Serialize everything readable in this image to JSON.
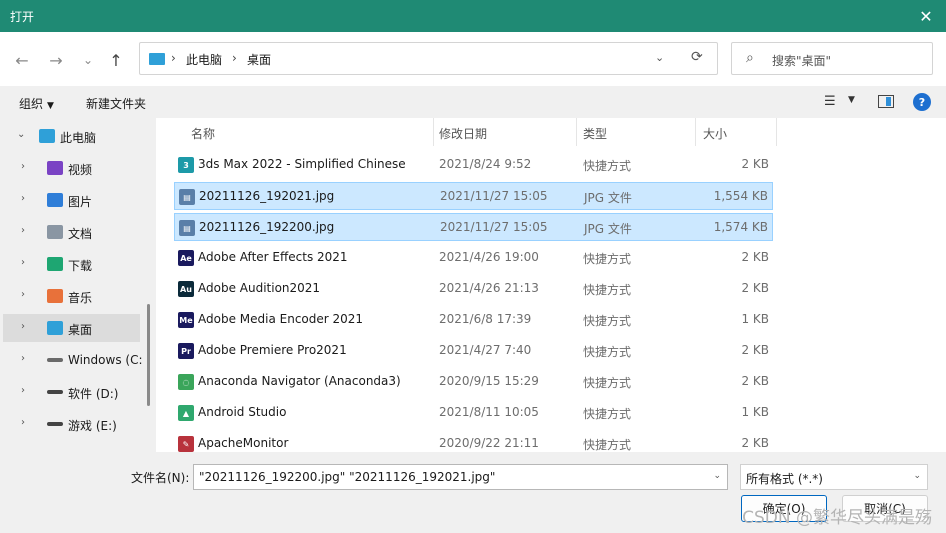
{
  "window": {
    "title": "打开",
    "close_glyph": "✕"
  },
  "nav": {
    "back": "←",
    "forward": "→",
    "recent": "⌄",
    "up": "↑"
  },
  "address": {
    "crumbs": [
      "此电脑",
      "桌面"
    ],
    "separator": "›",
    "dropdown": "⌄",
    "refresh": "⟳"
  },
  "search": {
    "placeholder": "搜索\"桌面\"",
    "icon": "⌕"
  },
  "toolbar": {
    "organize": "组织",
    "organize_arrow": "▼",
    "new_folder": "新建文件夹",
    "view_icon": "☰",
    "view_arrow": "▼",
    "help": "?"
  },
  "sidebar": {
    "items": [
      {
        "label": "此电脑",
        "icon": "pc-icon",
        "color": "#2fa0d8",
        "chevron": "⌄",
        "root": true
      },
      {
        "label": "视频",
        "icon": "video-icon",
        "color": "#7a43c4",
        "chevron": "›"
      },
      {
        "label": "图片",
        "icon": "pictures-icon",
        "color": "#2f7ed8",
        "chevron": "›"
      },
      {
        "label": "文档",
        "icon": "documents-icon",
        "color": "#8a96a3",
        "chevron": "›"
      },
      {
        "label": "下载",
        "icon": "download-icon",
        "color": "#1ea672",
        "chevron": "›"
      },
      {
        "label": "音乐",
        "icon": "music-icon",
        "color": "#e8713a",
        "chevron": "›"
      },
      {
        "label": "桌面",
        "icon": "desktop-icon",
        "color": "#2fa0d8",
        "chevron": "›",
        "selected": true
      },
      {
        "label": "Windows (C:",
        "icon": "drive-icon",
        "color": "#6a6a6a",
        "chevron": "›"
      },
      {
        "label": "软件 (D:)",
        "icon": "drive-icon",
        "color": "#444444",
        "chevron": "›"
      },
      {
        "label": "游戏 (E:)",
        "icon": "drive-icon",
        "color": "#444444",
        "chevron": "›"
      }
    ]
  },
  "columns": {
    "name": "名称",
    "date": "修改日期",
    "type": "类型",
    "size": "大小",
    "sort_arrow": "^"
  },
  "files": [
    {
      "name": "3ds Max 2022 - Simplified Chinese",
      "date": "2021/8/24 9:52",
      "type": "快捷方式",
      "size": "2 KB",
      "icon": "3dsmax-icon",
      "badge": "3",
      "color": "#1d9aa8"
    },
    {
      "name": "20211126_192021.jpg",
      "date": "2021/11/27 15:05",
      "type": "JPG 文件",
      "size": "1,554 KB",
      "icon": "jpg-file-icon",
      "badge": "▤",
      "color": "#5a7fa8",
      "selected": true
    },
    {
      "name": "20211126_192200.jpg",
      "date": "2021/11/27 15:05",
      "type": "JPG 文件",
      "size": "1,574 KB",
      "icon": "jpg-file-icon",
      "badge": "▤",
      "color": "#5a7fa8",
      "selected": true
    },
    {
      "name": "Adobe After Effects 2021",
      "date": "2021/4/26 19:00",
      "type": "快捷方式",
      "size": "2 KB",
      "icon": "after-effects-icon",
      "badge": "Ae",
      "color": "#1a1a5e"
    },
    {
      "name": "Adobe Audition2021",
      "date": "2021/4/26 21:13",
      "type": "快捷方式",
      "size": "2 KB",
      "icon": "audition-icon",
      "badge": "Au",
      "color": "#0b2a3a"
    },
    {
      "name": "Adobe Media Encoder 2021",
      "date": "2021/6/8 17:39",
      "type": "快捷方式",
      "size": "1 KB",
      "icon": "media-encoder-icon",
      "badge": "Me",
      "color": "#1a1a5e"
    },
    {
      "name": "Adobe Premiere Pro2021",
      "date": "2021/4/27 7:40",
      "type": "快捷方式",
      "size": "2 KB",
      "icon": "premiere-icon",
      "badge": "Pr",
      "color": "#1a1a5e"
    },
    {
      "name": "Anaconda Navigator (Anaconda3)",
      "date": "2020/9/15 15:29",
      "type": "快捷方式",
      "size": "2 KB",
      "icon": "anaconda-icon",
      "badge": "◌",
      "color": "#3aa55a"
    },
    {
      "name": "Android Studio",
      "date": "2021/8/11 10:05",
      "type": "快捷方式",
      "size": "1 KB",
      "icon": "android-studio-icon",
      "badge": "▲",
      "color": "#2fa86e"
    },
    {
      "name": "ApacheMonitor",
      "date": "2020/9/22 21:11",
      "type": "快捷方式",
      "size": "2 KB",
      "icon": "apache-monitor-icon",
      "badge": "✎",
      "color": "#b8323c"
    }
  ],
  "footer": {
    "filename_label": "文件名(N):",
    "filename_value": "\"20211126_192200.jpg\" \"20211126_192021.jpg\"",
    "filter_value": "所有格式 (*.*)",
    "dropdown": "⌄",
    "open_button": "确定(O)",
    "cancel_button": "取消(C)",
    "watermark": "CSDN @繁华尽头满是殇"
  }
}
